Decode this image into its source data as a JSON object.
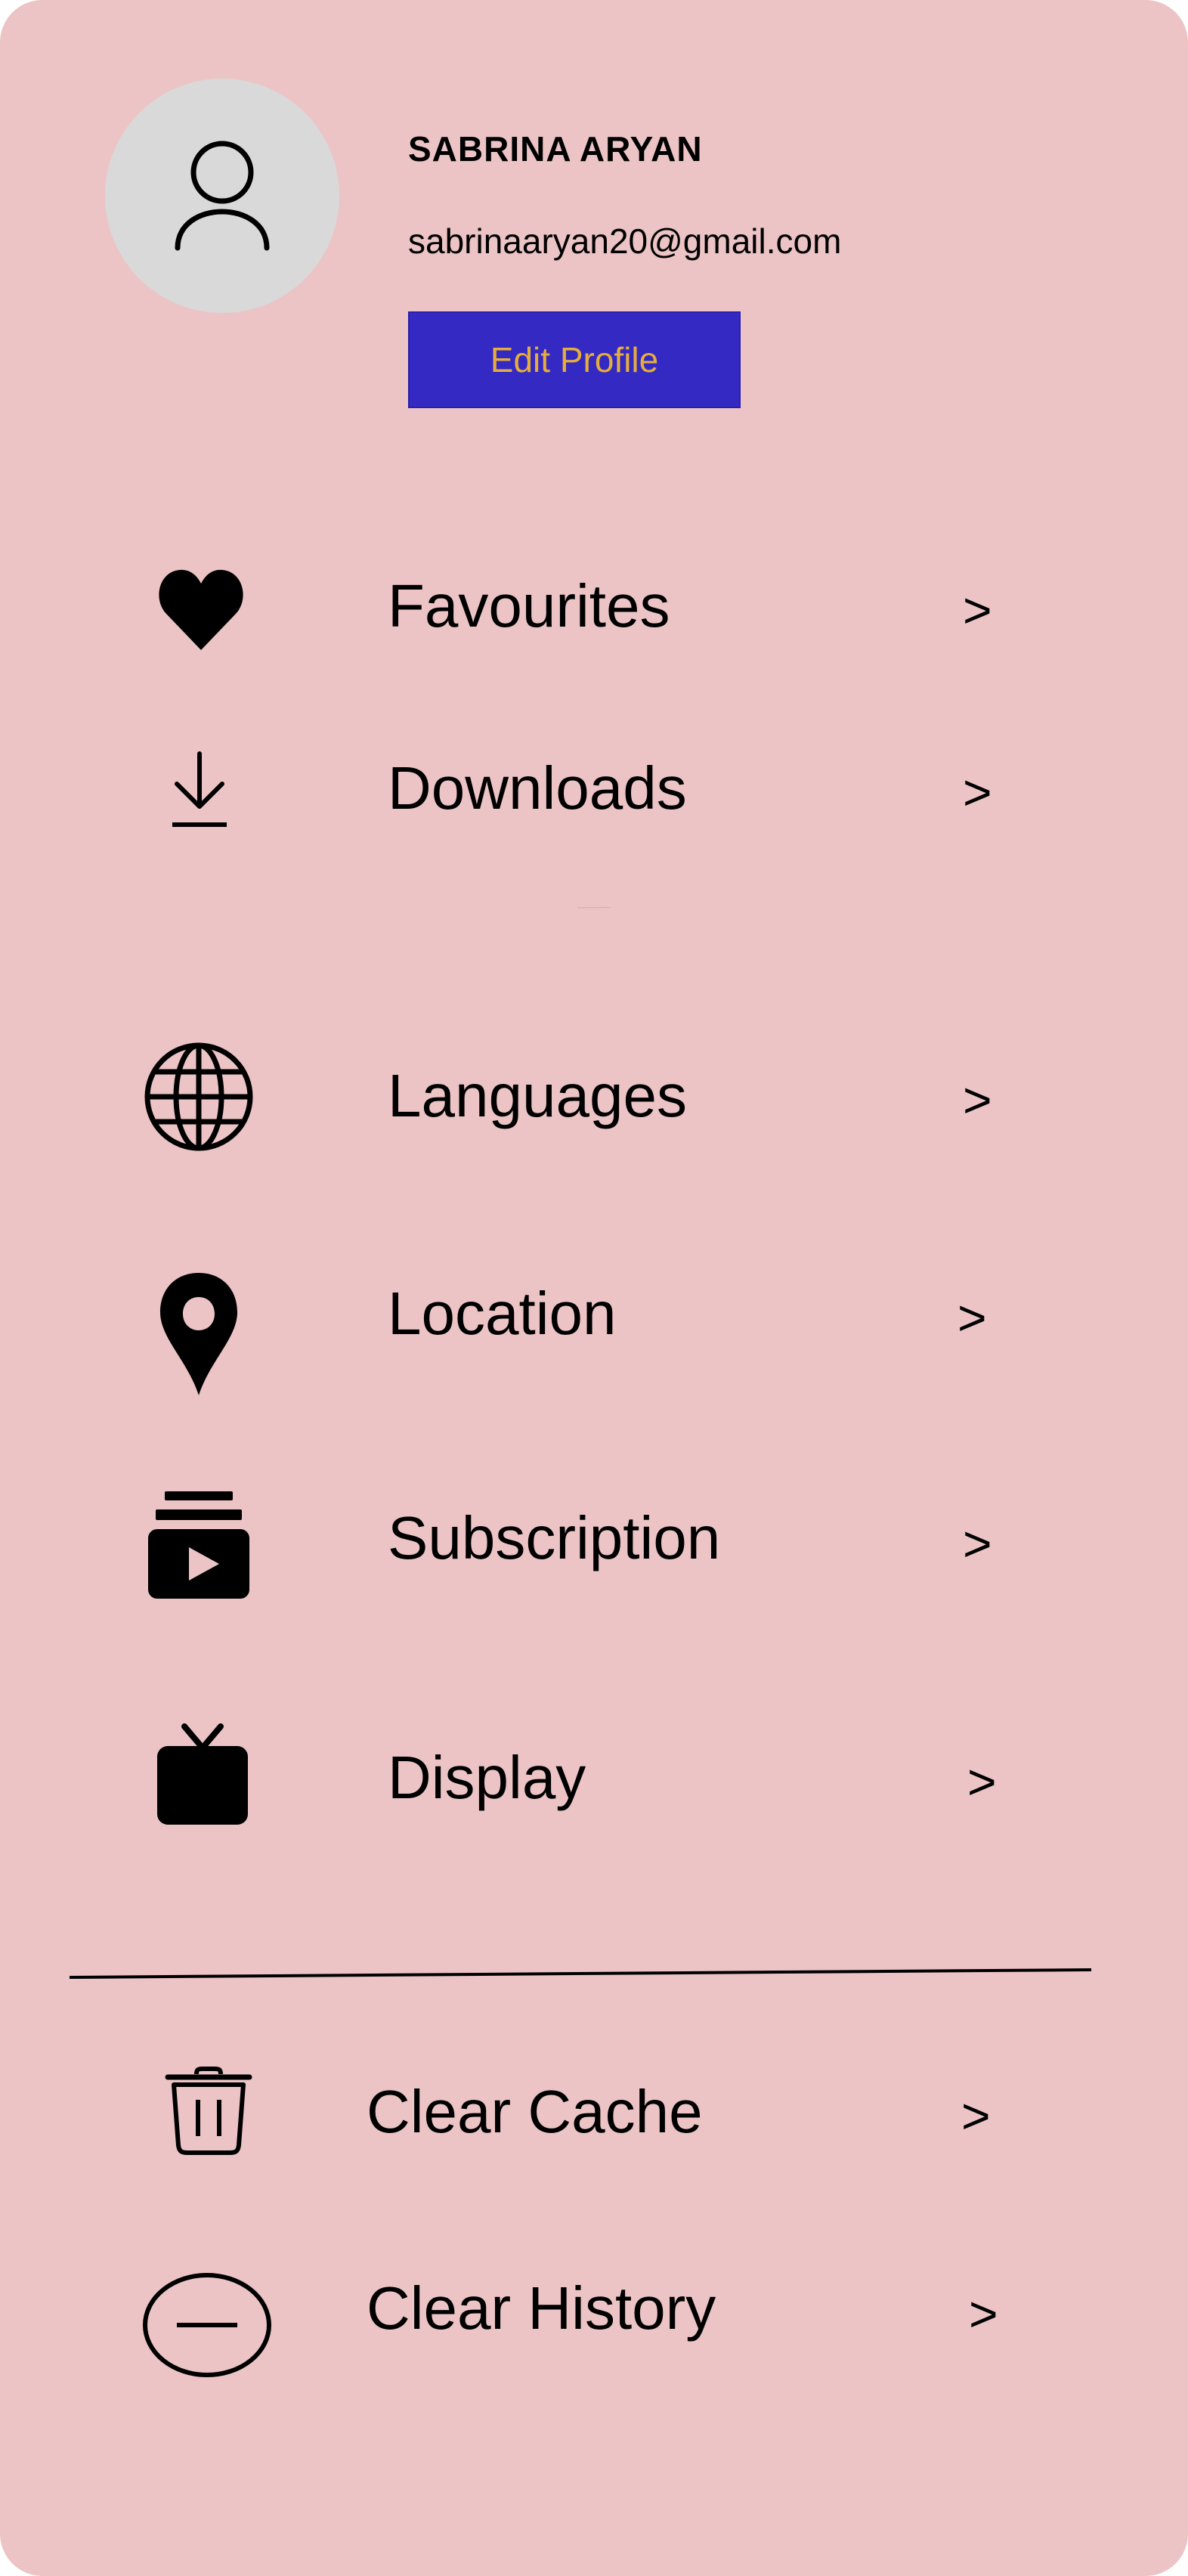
{
  "profile": {
    "name": "SABRINA ARYAN",
    "email": "sabrinaaryan20@gmail.com",
    "edit_label": "Edit Profile",
    "avatar_icon": "user-icon"
  },
  "menu": {
    "chevron": ">",
    "items": [
      {
        "label": "Favourites",
        "icon": "heart-icon"
      },
      {
        "label": "Downloads",
        "icon": "download-icon"
      },
      {
        "label": "Languages",
        "icon": "globe-icon"
      },
      {
        "label": "Location",
        "icon": "location-pin-icon"
      },
      {
        "label": "Subscription",
        "icon": "subscription-icon"
      },
      {
        "label": "Display",
        "icon": "tv-icon"
      },
      {
        "label": "Clear Cache",
        "icon": "trash-icon"
      },
      {
        "label": "Clear History",
        "icon": "minus-circle-icon"
      }
    ]
  },
  "colors": {
    "background": "#ecc4c5",
    "avatar_bg": "#d9d9d9",
    "button_bg": "#3429c3",
    "button_text": "#e4ad3d"
  }
}
